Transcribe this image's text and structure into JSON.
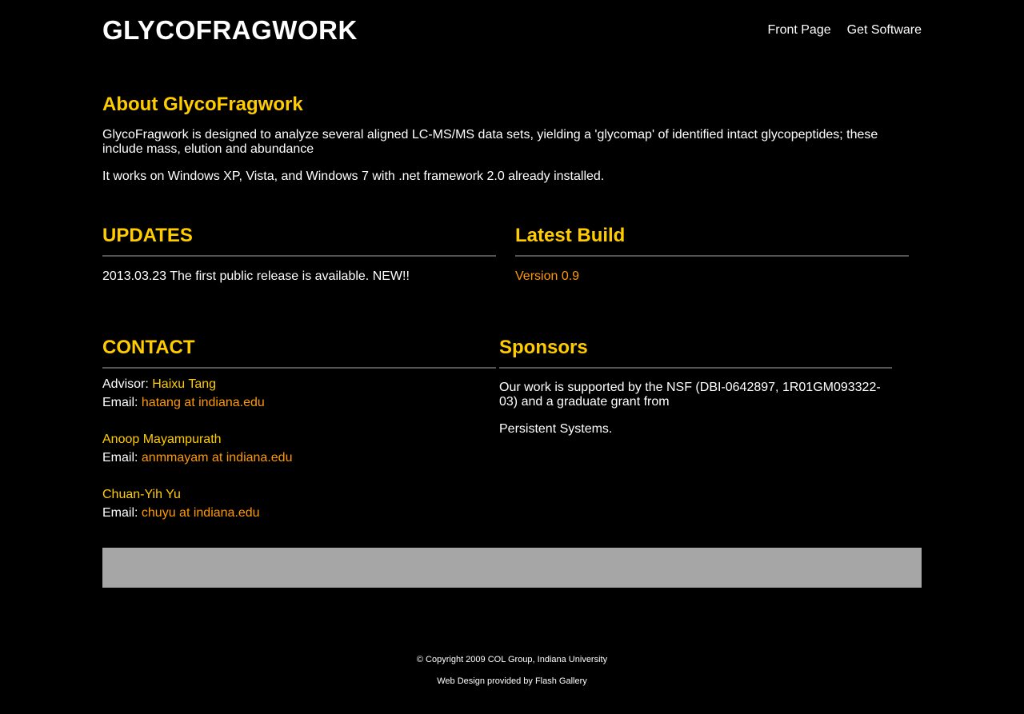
{
  "header": {
    "site_title": "GLYCOFRAGWORK",
    "nav": [
      {
        "label": "Front Page"
      },
      {
        "label": "Get Software"
      }
    ]
  },
  "about": {
    "heading": "About GlycoFragwork",
    "paragraphs": [
      "GlycoFragwork is designed to analyze several aligned LC-MS/MS data sets, yielding a 'glycomap' of identified intact glycopeptides; these include mass, elution and abundance",
      "It works on Windows XP, Vista, and Windows 7 with .net framework 2.0 already installed."
    ]
  },
  "updates": {
    "heading": "UPDATES",
    "text": "2013.03.23 The first public release is available. NEW!!"
  },
  "latest_build": {
    "heading": "Latest Build",
    "link": "Version 0.9"
  },
  "contact": {
    "heading": "CONTACT",
    "advisor_label": "Advisor:",
    "email_label": "Email:",
    "people": [
      {
        "name": "Haixu Tang",
        "email": "hatang at indiana.edu"
      },
      {
        "name": "Anoop Mayampurath",
        "email": "anmmayam at indiana.edu"
      },
      {
        "name": "Chuan-Yih Yu",
        "email": "chuyu at indiana.edu"
      }
    ]
  },
  "sponsors": {
    "heading": "Sponsors",
    "paragraphs": [
      "Our work is supported by the NSF (DBI-0642897, 1R01GM093322-03) and a graduate grant from",
      "Persistent Systems."
    ]
  },
  "footer": {
    "copyright": "© Copyright 2009 COL Group, Indiana University",
    "credit": "Web Design provided by Flash Gallery"
  },
  "colors": {
    "background": "#000000",
    "heading": "#ffcc00",
    "link": "#ff9900",
    "banner": "#a6a6a6",
    "rule": "#555555"
  }
}
